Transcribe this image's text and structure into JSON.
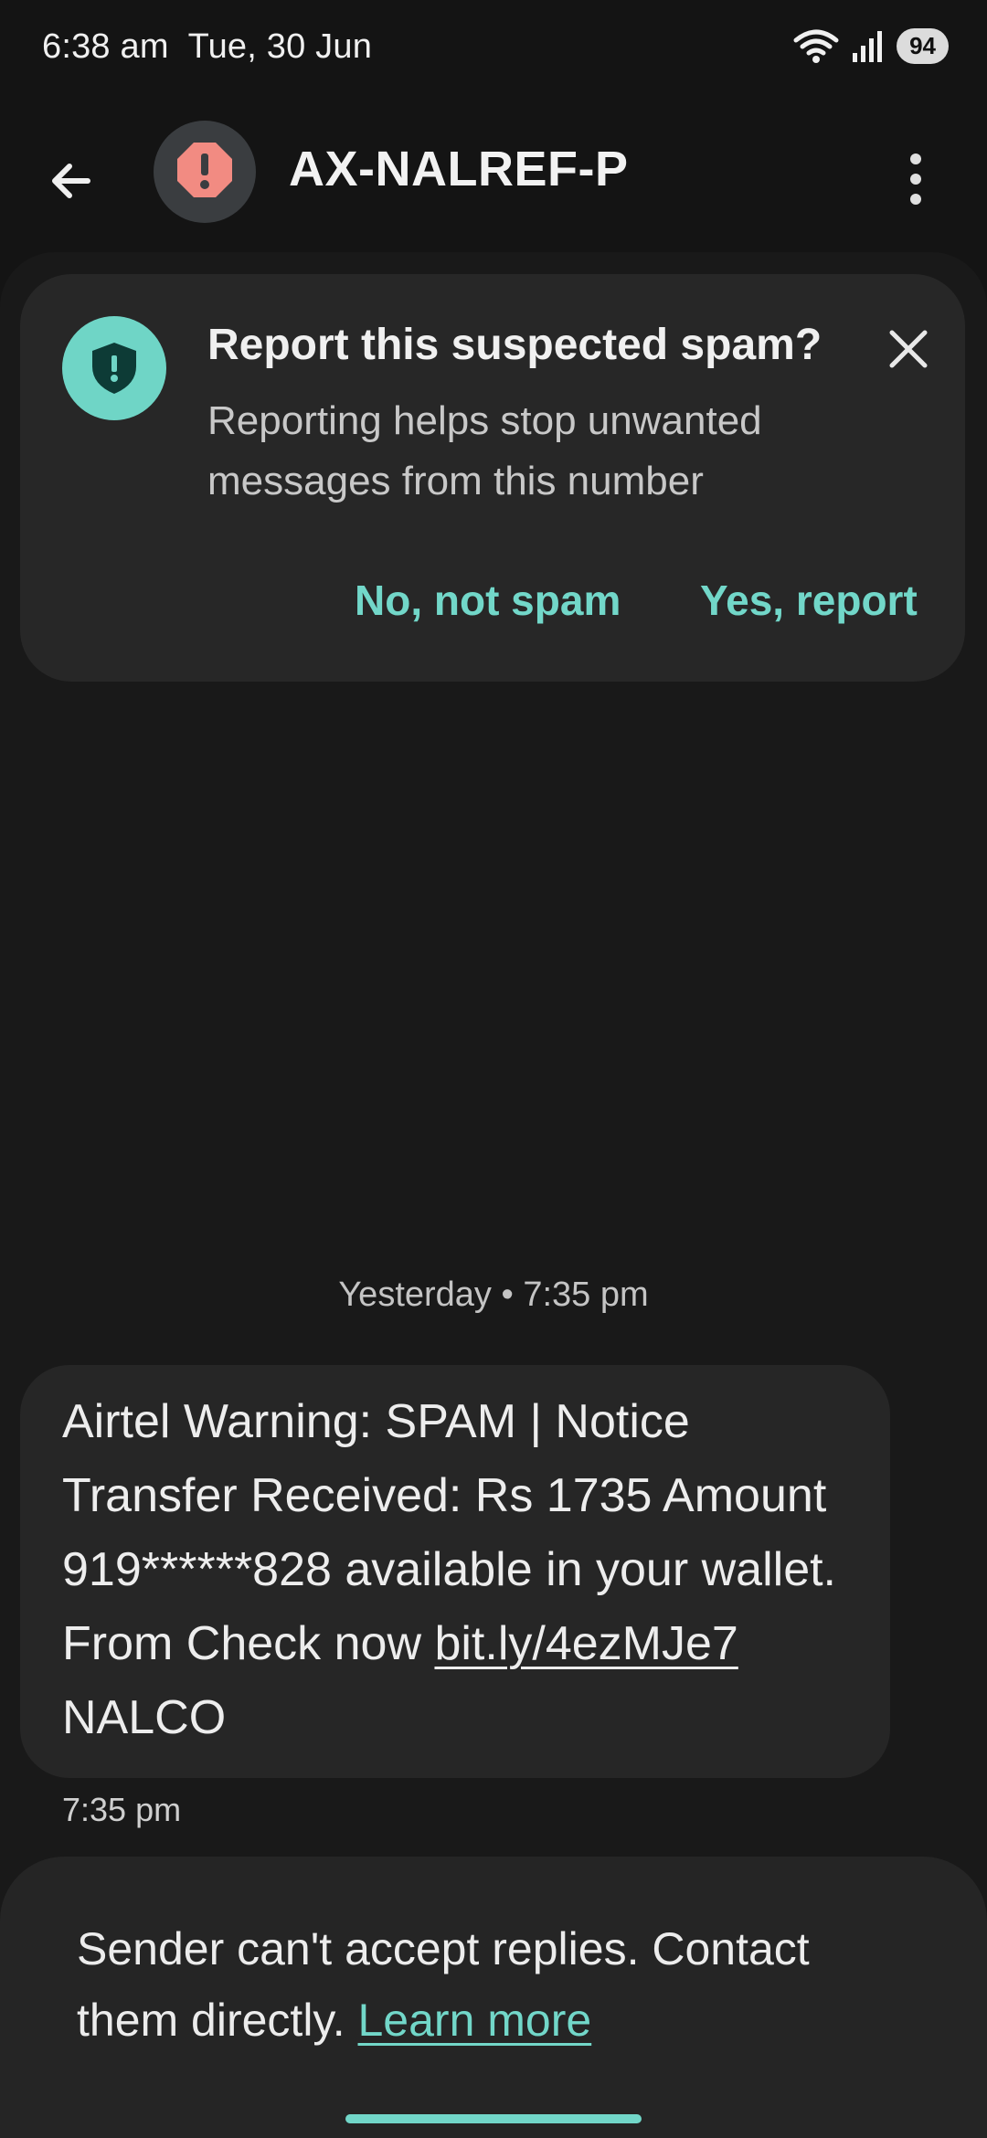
{
  "status_bar": {
    "time": "6:38 am",
    "date": "Tue, 30 Jun",
    "battery": "94",
    "icons": [
      "wifi-icon",
      "signal-icon",
      "battery-icon"
    ]
  },
  "header": {
    "back_icon": "arrow-left-icon",
    "avatar_icon": "alert-octagon-icon",
    "title": "AX-NALREF-P",
    "menu_icon": "more-vertical-icon"
  },
  "spam_banner": {
    "icon": "shield-alert-icon",
    "title": "Report this suspected spam?",
    "body": "Reporting helps stop unwanted messages from this number",
    "close_icon": "close-icon",
    "no_label": "No, not spam",
    "yes_label": "Yes, report"
  },
  "conversation": {
    "date_divider": "Yesterday • 7:35 pm",
    "message": {
      "text_before_link": "Airtel Warning: SPAM | Notice Transfer Received: Rs 1735 Amount 919******828 available in your wallet. From Check now ",
      "link": "bit.ly/4ezMJe7",
      "text_after_link": " NALCO",
      "time": "7:35 pm"
    }
  },
  "footer": {
    "text": "Sender can't accept replies. Contact them directly. ",
    "link": "Learn more"
  },
  "colors": {
    "background": "#141414",
    "accent": "#72d7c9",
    "spam_avatar": "#f28b82",
    "card": "#272727"
  }
}
